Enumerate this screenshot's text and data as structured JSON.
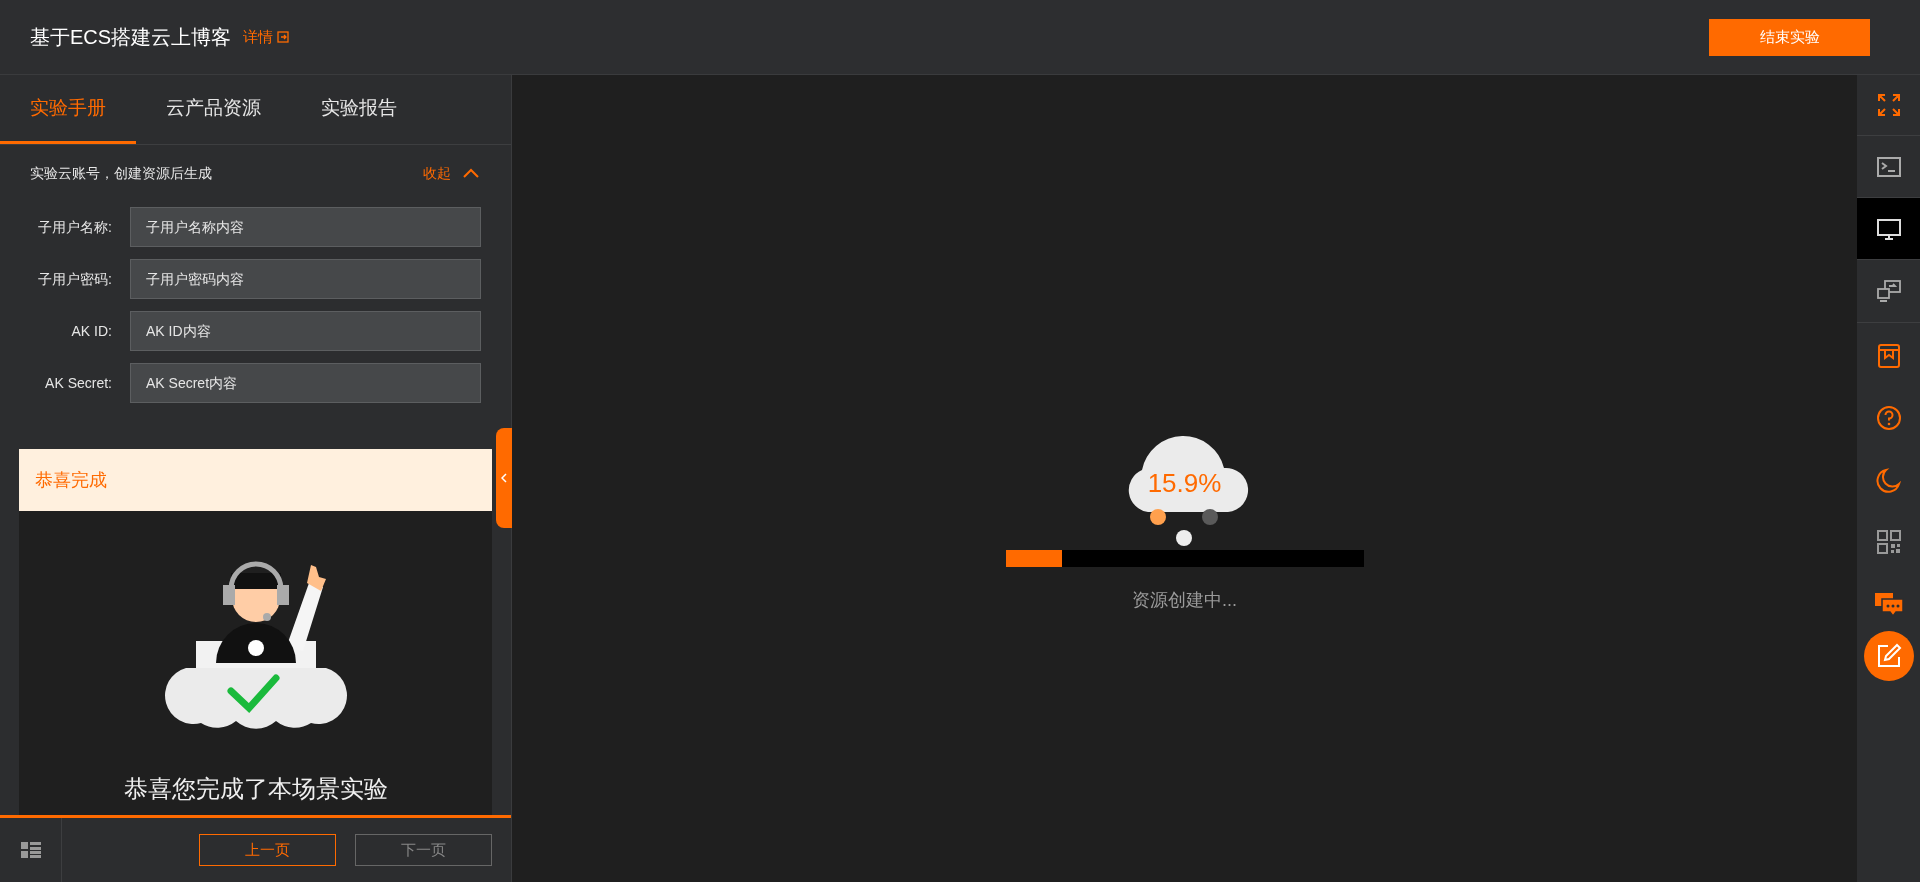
{
  "header": {
    "title": "基于ECS搭建云上博客",
    "details_link": "详情",
    "end_button": "结束实验"
  },
  "tabs": [
    {
      "label": "实验手册",
      "selected": true
    },
    {
      "label": "云产品资源",
      "selected": false
    },
    {
      "label": "实验报告",
      "selected": false
    }
  ],
  "account": {
    "note": "实验云账号，创建资源后生成",
    "collapse_link": "收起",
    "expanded": true,
    "fields": [
      {
        "label": "子用户名称:",
        "value": "子用户名称内容"
      },
      {
        "label": "子用户密码:",
        "value": "子用户密码内容"
      },
      {
        "label": "AK ID:",
        "value": "AK ID内容"
      },
      {
        "label": "AK Secret:",
        "value": "AK Secret内容"
      }
    ]
  },
  "card": {
    "title": "恭喜完成",
    "heading": "恭喜您完成了本场景实验"
  },
  "footer": {
    "prev_button": {
      "label": "上一页",
      "disabled": false
    },
    "next_button": {
      "label": "下一页",
      "disabled": true
    }
  },
  "loader": {
    "percent": "15.9%",
    "level": 0.159,
    "status": "资源创建中..."
  },
  "view_buttons": [
    {
      "selected": false
    },
    {
      "selected": false
    },
    {
      "selected": true
    },
    {
      "selected": false
    }
  ]
}
